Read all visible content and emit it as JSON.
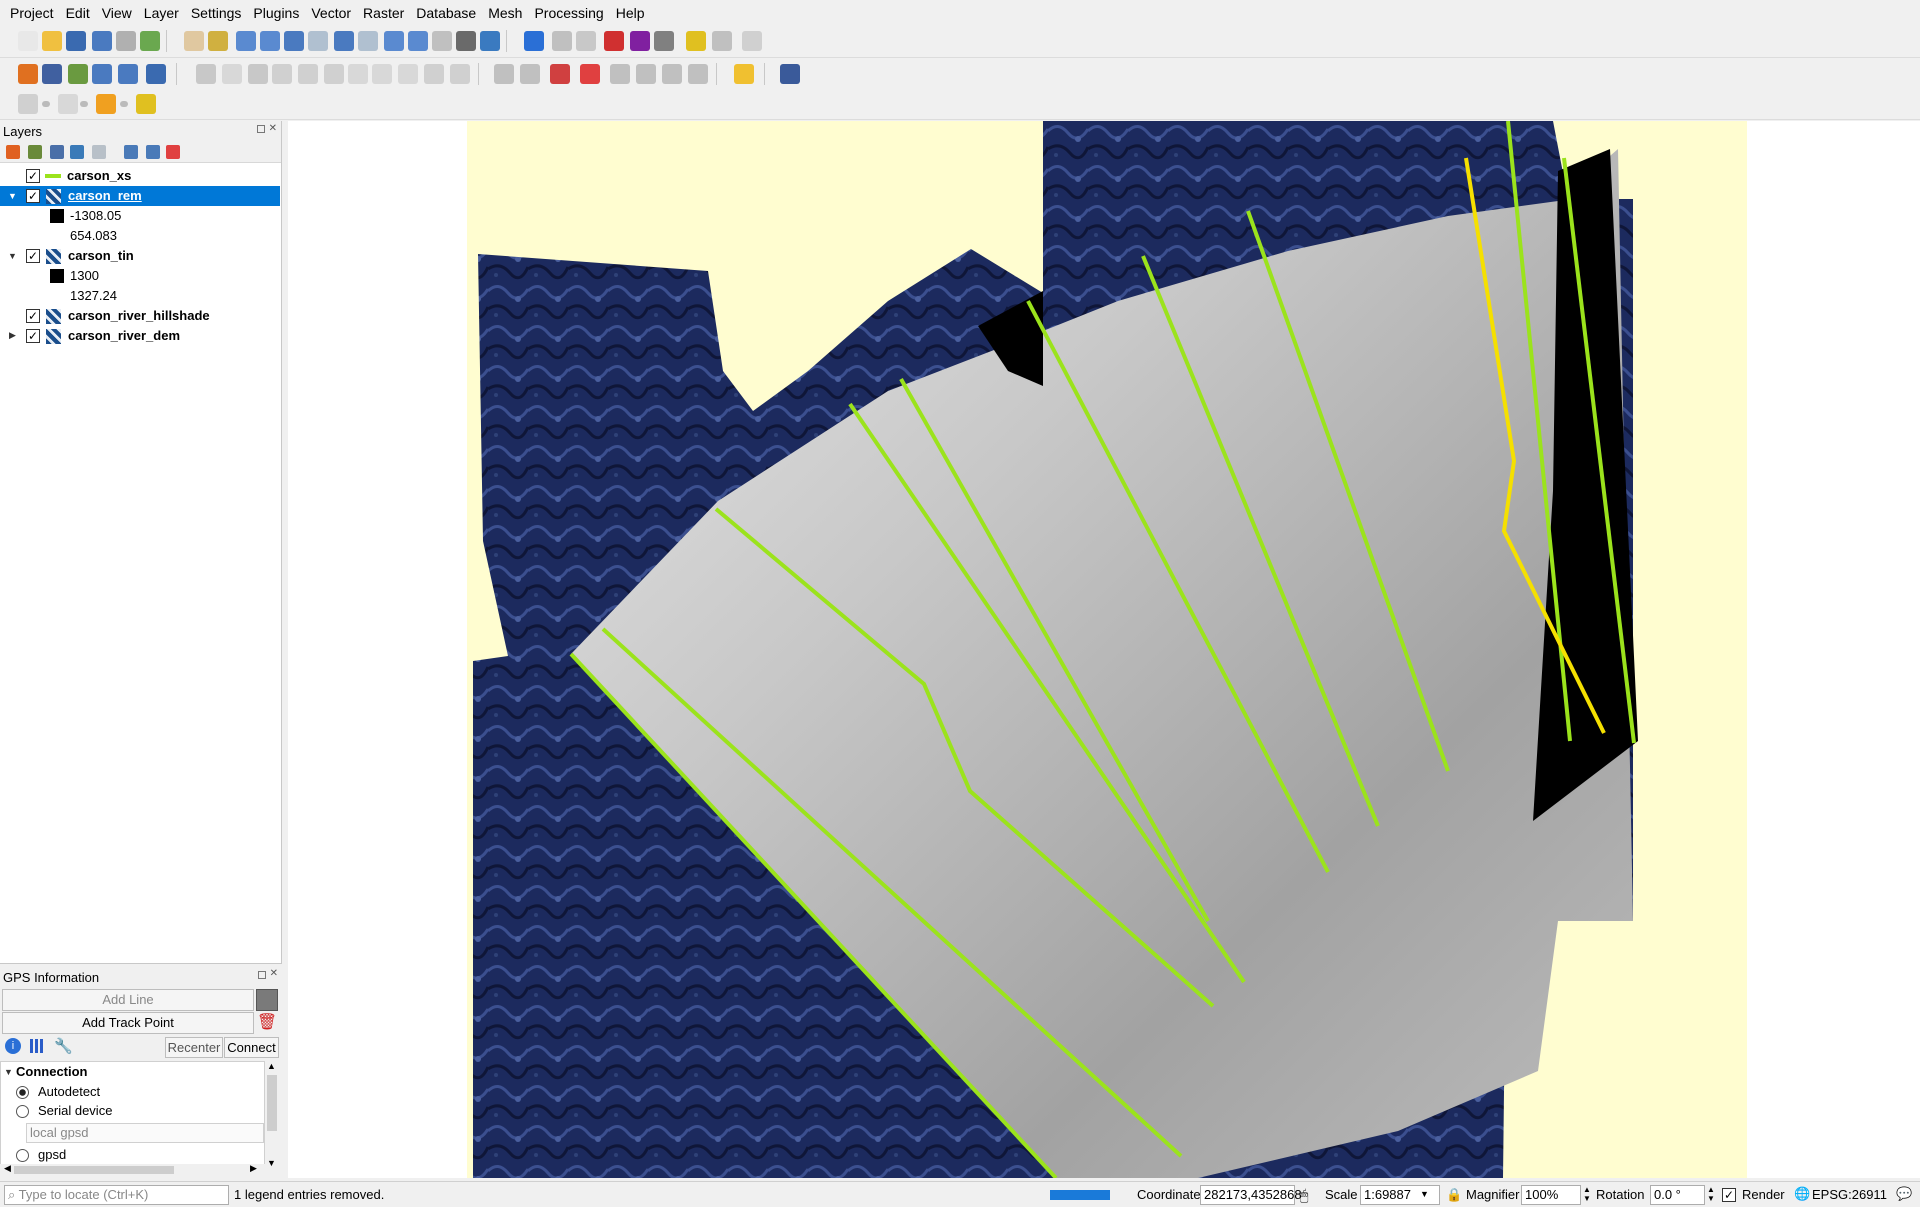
{
  "menu": [
    "Project",
    "Edit",
    "View",
    "Layer",
    "Settings",
    "Plugins",
    "Vector",
    "Raster",
    "Database",
    "Mesh",
    "Processing",
    "Help"
  ],
  "layers_panel": {
    "title": "Layers",
    "layers": [
      {
        "name": "carson_xs",
        "checked": true,
        "expanded": null,
        "icon": "line-legend-icon",
        "selected": false
      },
      {
        "name": "carson_rem",
        "checked": true,
        "expanded": true,
        "icon": "raster-layer-icon",
        "selected": true
      },
      {
        "name": "carson_tin",
        "checked": true,
        "expanded": true,
        "icon": "mesh-layer-icon",
        "selected": false
      },
      {
        "name": "carson_river_hillshade",
        "checked": true,
        "expanded": null,
        "icon": "raster-layer-icon",
        "selected": false
      },
      {
        "name": "carson_river_dem",
        "checked": true,
        "expanded": false,
        "icon": "raster-layer-icon",
        "selected": false
      }
    ],
    "rem_legend": [
      "-1308.05",
      "654.083"
    ],
    "tin_legend": [
      "1300",
      "1327.24"
    ]
  },
  "gps_panel": {
    "title": "GPS Information",
    "add_line": "Add Line",
    "add_track_point": "Add Track Point",
    "recenter": "Recenter",
    "connect": "Connect",
    "connection_header": "Connection",
    "options": [
      "Autodetect",
      "Serial device"
    ],
    "local_gpsd_placeholder": "local gpsd",
    "gpsd": "gpsd",
    "selected_option": "Autodetect"
  },
  "status": {
    "locate_placeholder": "Type to locate (Ctrl+K)",
    "message": "1 legend entries removed.",
    "coordinate_label": "Coordinate",
    "coordinate": "282173,4352868",
    "scale_label": "Scale",
    "scale": "1:69887",
    "magnifier_label": "Magnifier",
    "magnifier": "100%",
    "rotation_label": "Rotation",
    "rotation": "0.0 °",
    "render_label": "Render",
    "crs": "EPSG:26911"
  },
  "colors": {
    "selection": "#0078d7",
    "xs_line": "#9be31c",
    "bank_line": "#f5e000",
    "hillshade": "#1c2a5e",
    "background": "#fffdd0"
  }
}
